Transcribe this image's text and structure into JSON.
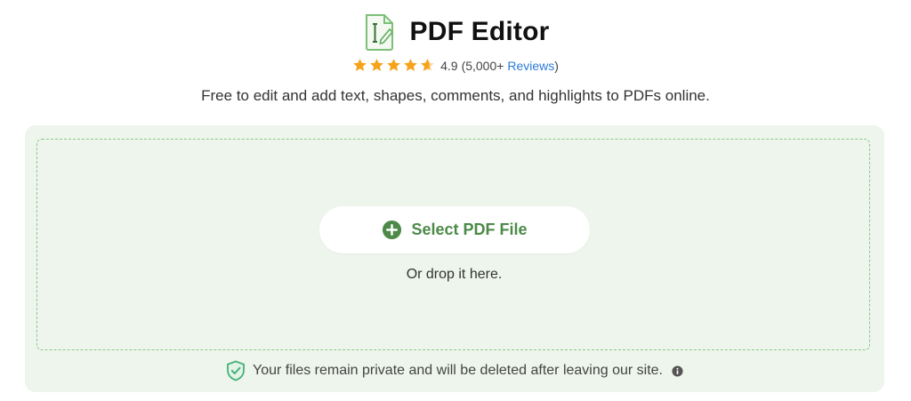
{
  "header": {
    "title": "PDF Editor",
    "logo_icon": "pdf-edit-document-icon"
  },
  "rating": {
    "stars": 4.9,
    "score": "4.9",
    "count_text": "(5,000+",
    "reviews_label": "Reviews",
    "closing": ")",
    "star_color": "#f7a21b"
  },
  "subtitle": "Free to edit and add text, shapes, comments, and highlights to PDFs online.",
  "upload": {
    "select_button_label": "Select PDF File",
    "button_icon": "plus-circle-icon",
    "drop_hint": "Or drop it here.",
    "accent_color": "#4d8a48",
    "panel_color": "#eef5ec"
  },
  "privacy": {
    "text": "Your files remain private and will be deleted after leaving our site.",
    "shield_icon": "shield-check-icon",
    "info_icon": "info-icon"
  }
}
